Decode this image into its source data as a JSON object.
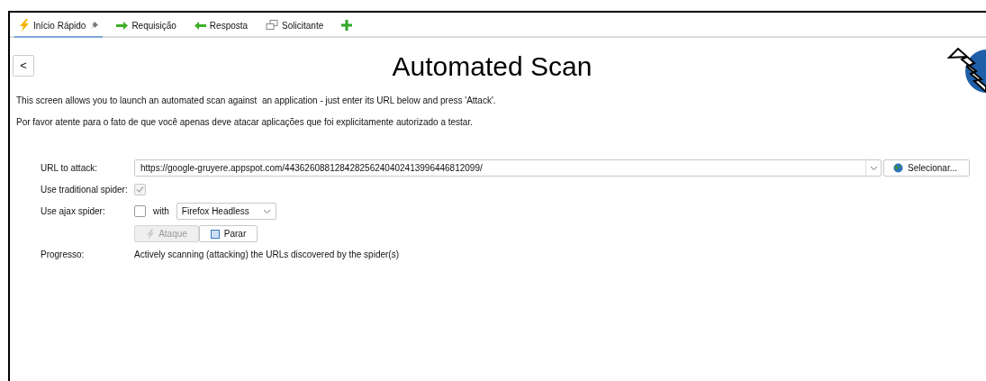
{
  "tabs": [
    {
      "label": "Início Rápido",
      "kind": "quickstart",
      "selected": true,
      "pinned": true
    },
    {
      "label": "Requisição",
      "kind": "request",
      "selected": false
    },
    {
      "label": "Resposta",
      "kind": "response",
      "selected": false
    },
    {
      "label": "Solicitante",
      "kind": "requester",
      "selected": false
    },
    {
      "kind": "add",
      "selected": false
    }
  ],
  "back_button": "<",
  "title": "Automated Scan",
  "intro": [
    "This screen allows you to launch an automated scan against  an application - just enter its URL below and press 'Attack'.",
    "Por favor atente para o fato de que você apenas deve atacar aplicações que foi explicitamente autorizado a testar."
  ],
  "form": {
    "url_label": "URL to attack:",
    "url_value": "https://google-gruyere.appspot.com/443626088128428256240402413996446812099/",
    "select_button": "Selecionar...",
    "traditional_label": "Use traditional spider:",
    "traditional_checked": true,
    "traditional_disabled": true,
    "ajax_label": "Use ajax spider:",
    "ajax_checked": false,
    "with_label": "with",
    "browser": "Firefox Headless",
    "attack_button": "Ataque",
    "attack_disabled": true,
    "stop_button": "Parar",
    "stop_disabled": false,
    "progress_label": "Progresso:",
    "progress_text": "Actively scanning (attacking) the URLs discovered by the spider(s)"
  }
}
